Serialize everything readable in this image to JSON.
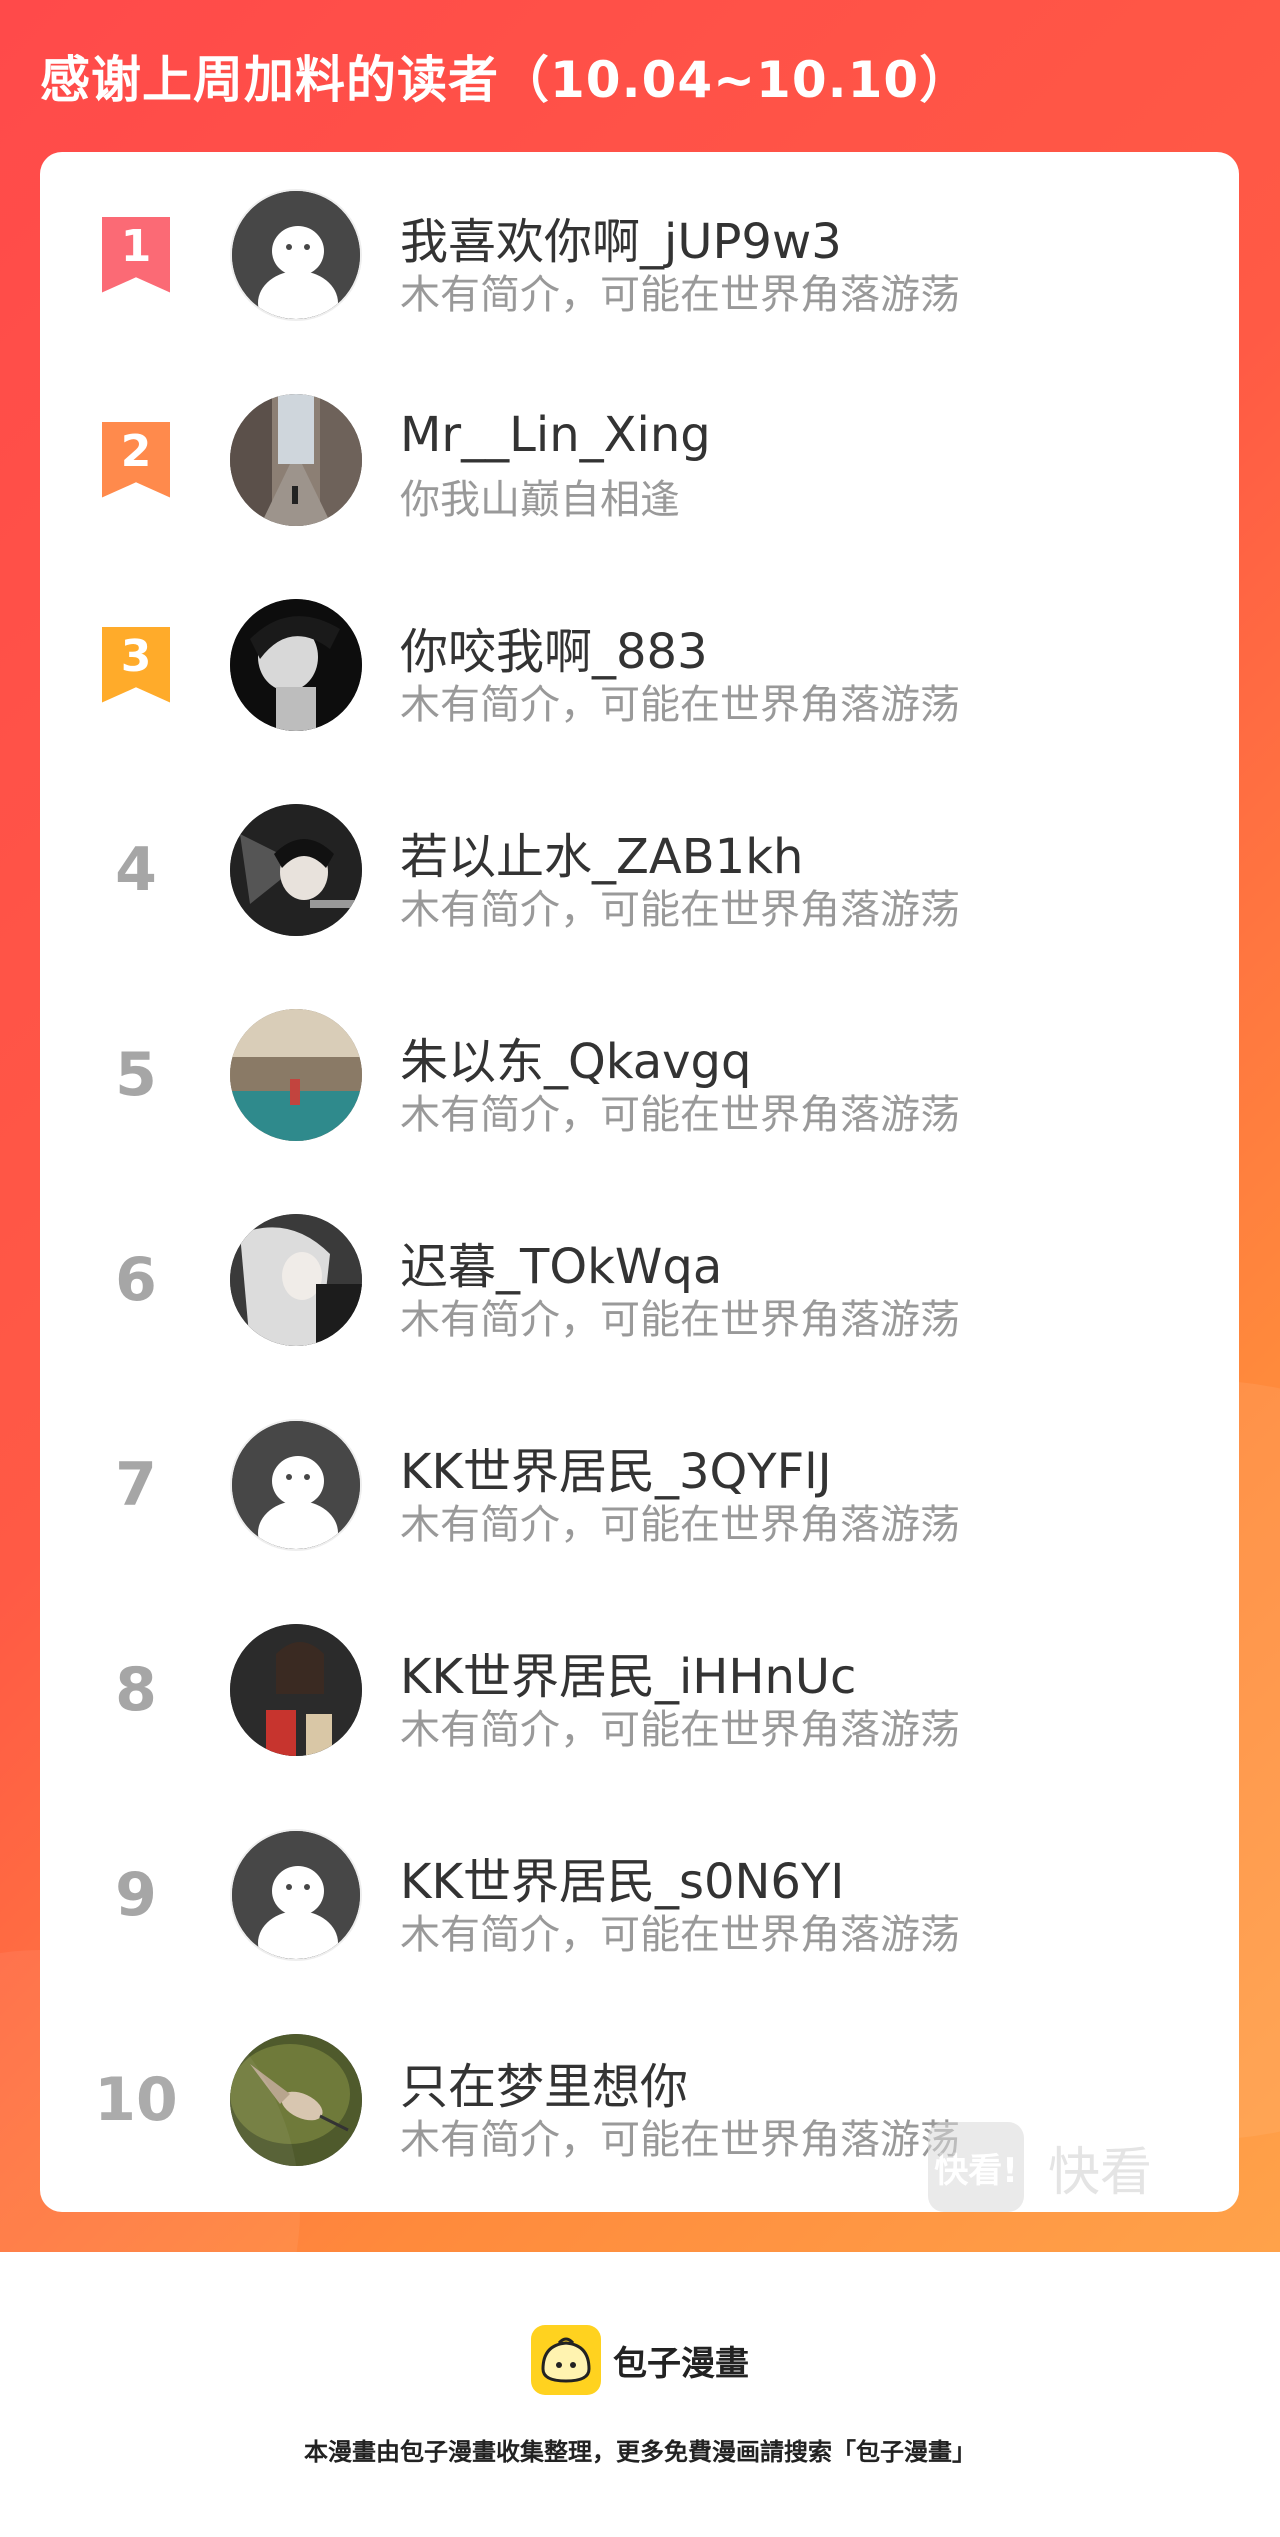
{
  "title": "感谢上周加料的读者（10.04~10.10）",
  "colors": {
    "rank1": "#fb6a75",
    "rank2": "#ff8a4c",
    "rank3": "#ffab2a"
  },
  "readers": [
    {
      "rank": "1",
      "name": "我喜欢你啊_jUP9w3",
      "bio": "木有简介，可能在世界角落游荡",
      "avatar": "default-avatar"
    },
    {
      "rank": "2",
      "name": "Mr__Lin_Xing",
      "bio": "你我山巅自相逢",
      "avatar": "city-street-photo"
    },
    {
      "rank": "3",
      "name": "你咬我啊_883",
      "bio": "木有简介，可能在世界角落游荡",
      "avatar": "bw-portrait-photo"
    },
    {
      "rank": "4",
      "name": "若以止水_ZAB1kh",
      "bio": "木有简介，可能在世界角落游荡",
      "avatar": "anime-character"
    },
    {
      "rank": "5",
      "name": "朱以东_Qkavgq",
      "bio": "木有简介，可能在世界角落游荡",
      "avatar": "lake-scenery-photo"
    },
    {
      "rank": "6",
      "name": "迟暮_TOkWqa",
      "bio": "木有简介，可能在世界角落游荡",
      "avatar": "white-hair-character"
    },
    {
      "rank": "7",
      "name": "KK世界居民_3QYFlJ",
      "bio": "木有简介，可能在世界角落游荡",
      "avatar": "default-avatar"
    },
    {
      "rank": "8",
      "name": "KK世界居民_iHHnUc",
      "bio": "木有简介，可能在世界角落游荡",
      "avatar": "group-photo"
    },
    {
      "rank": "9",
      "name": "KK世界居民_s0N6YI",
      "bio": "木有简介，可能在世界角落游荡",
      "avatar": "default-avatar"
    },
    {
      "rank": "10",
      "name": "只在梦里想你",
      "bio": "木有简介，可能在世界角落游荡",
      "avatar": "hummingbird-photo"
    }
  ],
  "watermark": {
    "logo_text": "快看!",
    "text": "快看"
  },
  "footer": {
    "brand": "包子漫畫",
    "disclaimer": "本漫畫由包子漫畫收集整理，更多免費漫画請搜索「包子漫畫」"
  }
}
